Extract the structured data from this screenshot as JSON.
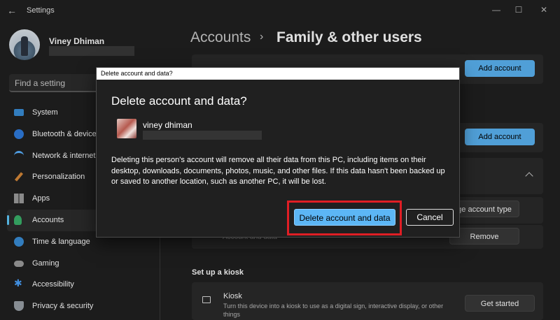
{
  "window": {
    "title": "Settings",
    "back_icon": "arrow-left-icon",
    "minimize_glyph": "—",
    "maximize_glyph": "☐",
    "close_glyph": "✕"
  },
  "profile": {
    "name": "Viney Dhiman"
  },
  "search": {
    "placeholder": "Find a setting"
  },
  "sidebar": {
    "items": [
      {
        "label": "System",
        "icon": "monitor-icon"
      },
      {
        "label": "Bluetooth & devices",
        "icon": "bluetooth-icon"
      },
      {
        "label": "Network & internet",
        "icon": "wifi-icon"
      },
      {
        "label": "Personalization",
        "icon": "brush-icon"
      },
      {
        "label": "Apps",
        "icon": "apps-icon"
      },
      {
        "label": "Accounts",
        "icon": "person-icon",
        "active": true
      },
      {
        "label": "Time & language",
        "icon": "globe-icon"
      },
      {
        "label": "Gaming",
        "icon": "gamepad-icon"
      },
      {
        "label": "Accessibility",
        "icon": "accessibility-icon"
      },
      {
        "label": "Privacy & security",
        "icon": "shield-icon"
      }
    ]
  },
  "breadcrumb": {
    "parent": "Accounts",
    "separator": "›",
    "current": "Family & other users"
  },
  "main": {
    "add_account_1": "Add account",
    "add_account_2": "Add account",
    "change_account_type": "ge account type",
    "account_and_data_label": "Account and data",
    "remove": "Remove",
    "kiosk_section_title": "Set up a kiosk",
    "kiosk_title": "Kiosk",
    "kiosk_desc": "Turn this device into a kiosk to use as a digital sign, interactive display, or other things",
    "get_started": "Get started"
  },
  "dialog": {
    "caption": "Delete account and data?",
    "heading": "Delete account and data?",
    "user_name": "viney dhiman",
    "message": "Deleting this person's account will remove all their data from this PC, including items on their desktop, downloads, documents, photos, music, and other files. If this data hasn't been backed up or saved to another location, such as another PC, it will be lost.",
    "delete_button": "Delete account and data",
    "cancel_button": "Cancel",
    "highlight_color": "#e01e25"
  },
  "colors": {
    "accent": "#5cb6f5",
    "background": "#202020",
    "card": "#2b2b2b"
  }
}
